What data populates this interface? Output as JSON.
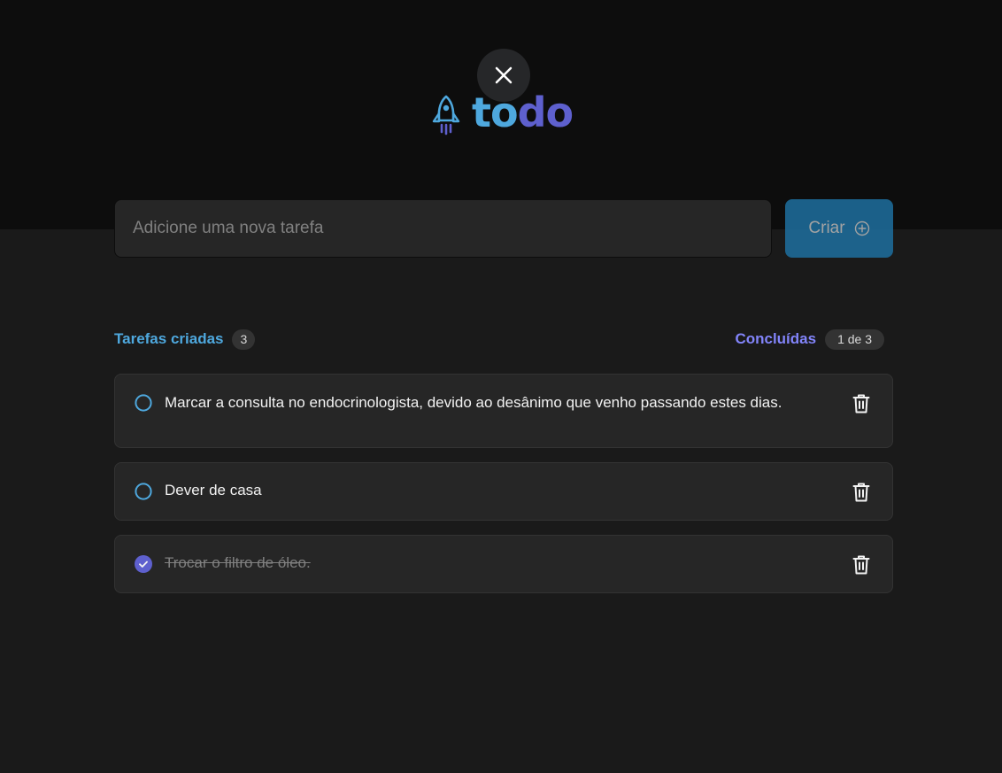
{
  "app": {
    "logo_text_part1": "to",
    "logo_text_part2": "do",
    "icons": {
      "close": "close-icon",
      "logo": "rocket-icon",
      "create": "plus-circle-icon",
      "unchecked": "circle-icon",
      "checked": "check-circle-icon",
      "delete": "trash-icon"
    },
    "colors": {
      "blue": "#4ea8de",
      "purple": "#5e60ce",
      "purple_light": "#8284fa",
      "blue_dark": "#1e6f9f"
    }
  },
  "new_task": {
    "placeholder": "Adicione uma nova tarefa",
    "value": "",
    "create_label": "Criar"
  },
  "counters": {
    "created_label": "Tarefas criadas",
    "created_count": "3",
    "done_label": "Concluídas",
    "done_count": "1 de 3"
  },
  "tasks": [
    {
      "text": "Marcar a consulta no endocrinologista, devido ao desânimo que venho passando estes dias.",
      "done": false
    },
    {
      "text": "Dever de casa",
      "done": false
    },
    {
      "text": "Trocar o filtro de óleo.",
      "done": true
    }
  ]
}
